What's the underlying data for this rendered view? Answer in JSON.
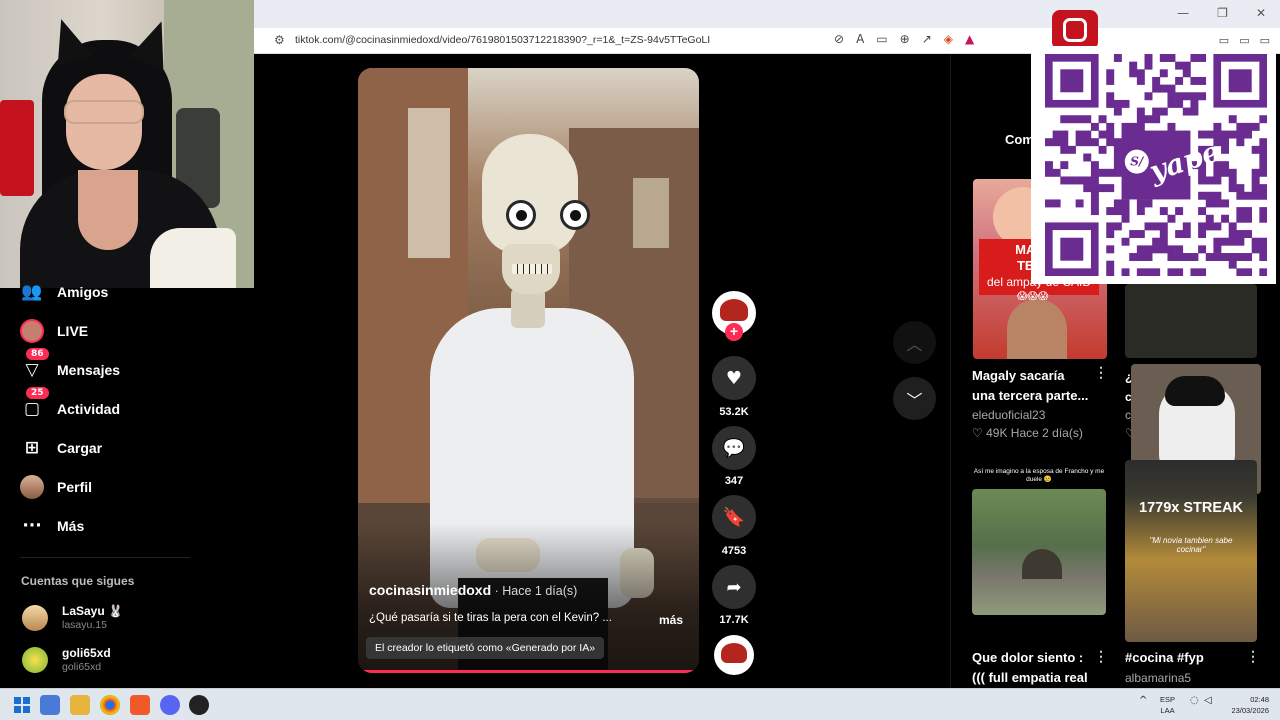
{
  "browser": {
    "url": "tiktok.com/@cocinasinmiedoxd/video/7619801503712218390?_r=1&_t=ZS-94v5TTeGoLI",
    "window_controls": [
      "—",
      "❐",
      "✕"
    ]
  },
  "sidebar": {
    "items": [
      {
        "label": "Amigos",
        "icon": "people-icon"
      },
      {
        "label": "LIVE",
        "icon": "live-avatar"
      },
      {
        "label": "Mensajes",
        "icon": "messages-icon",
        "badge": "86"
      },
      {
        "label": "Actividad",
        "icon": "activity-icon",
        "badge": "25"
      },
      {
        "label": "Cargar",
        "icon": "upload-icon"
      },
      {
        "label": "Perfil",
        "icon": "profile-avatar"
      },
      {
        "label": "Más",
        "icon": "more-icon"
      }
    ],
    "following_heading": "Cuentas que sigues",
    "following": [
      {
        "name": "LaSayu 🐰",
        "handle": "lasayu.15"
      },
      {
        "name": "goli65xd",
        "handle": "goli65xd"
      }
    ]
  },
  "video": {
    "author": "cocinasinmiedoxd",
    "time": " · Hace 1 día(s)",
    "description": "¿Qué pasaría si te tiras la pera con el Kevin? ...",
    "more_label": "más",
    "ai_label": "El creador lo etiquetó como «Generado por IA»",
    "progress": 0.98
  },
  "actions": {
    "likes": "53.2K",
    "comments": "347",
    "saves": "4753",
    "shares": "17.7K"
  },
  "right_panel": {
    "tab_label": "Com",
    "thumb1": {
      "banner_top": "MAGAL",
      "banner_mid": "TERCE",
      "banner_sub": "del ampay de CAID",
      "emoji": "😱😱😱"
    },
    "card1": {
      "title_line1": "Magaly sacaría",
      "title_line2": "una tercera parte...",
      "author": "eleduoficial23",
      "likes": "♡ 49K",
      "time": "Hace 2 día(s)"
    },
    "thumb5_caption": "Así me imagino a la esposa de Francho y me duele 😢",
    "card2": {
      "title_line1": "Que dolor siento :",
      "title_line2": "((( full empatia real"
    },
    "thumb4": {
      "streak": "1779x STREAK",
      "caption": "\"Mi novia tambien sabe cocinar\""
    },
    "card3": {
      "title_line1": "#cocina #fyp",
      "author": "albamarina5"
    },
    "partial_card": {
      "l1": "¿",
      "l2": "c",
      "l3": "c",
      "l4": "♡"
    }
  },
  "overlay": {
    "qr_brand": "yape",
    "qr_badge": "S/"
  },
  "taskbar": {
    "lang_top": "ESP",
    "lang_bottom": "LAA",
    "time": "02:48",
    "date": "23/03/2026"
  },
  "colors": {
    "accent": "#fe2c55",
    "qr": "#6a2c91",
    "page_bg": "#000000"
  }
}
